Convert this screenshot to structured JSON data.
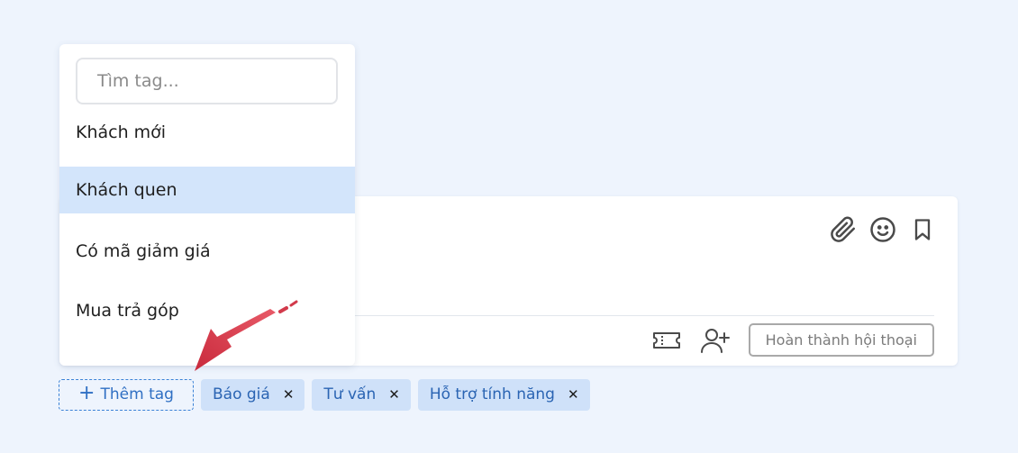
{
  "dropdown": {
    "search_placeholder": "Tìm tag...",
    "items": [
      {
        "label": "Khách mới",
        "selected": false
      },
      {
        "label": "Khách quen",
        "selected": true
      },
      {
        "label": "Có mã giảm giá",
        "selected": false
      },
      {
        "label": "Mua trả góp",
        "selected": false
      }
    ]
  },
  "composer": {
    "tools": [
      {
        "icon": "paperclip-icon"
      },
      {
        "icon": "smiley-icon"
      },
      {
        "icon": "bookmark-icon"
      }
    ],
    "footer": {
      "ticket_icon": "ticket-icon",
      "add_user_icon": "add-user-icon",
      "finish_label": "Hoàn thành hội thoại"
    }
  },
  "tags": {
    "add_label": "Thêm tag",
    "add_icon": "plus-icon",
    "remove_glyph": "✕",
    "items": [
      {
        "label": "Báo giá"
      },
      {
        "label": "Tư vấn"
      },
      {
        "label": "Hỗ trợ tính năng"
      }
    ]
  },
  "colors": {
    "background": "#eef4fd",
    "selected_item": "#d3e5fb",
    "tag_bg": "#cfe1f9",
    "tag_text": "#2a64b3",
    "accent": "#3b82d6",
    "arrow": "#d23a4b"
  }
}
